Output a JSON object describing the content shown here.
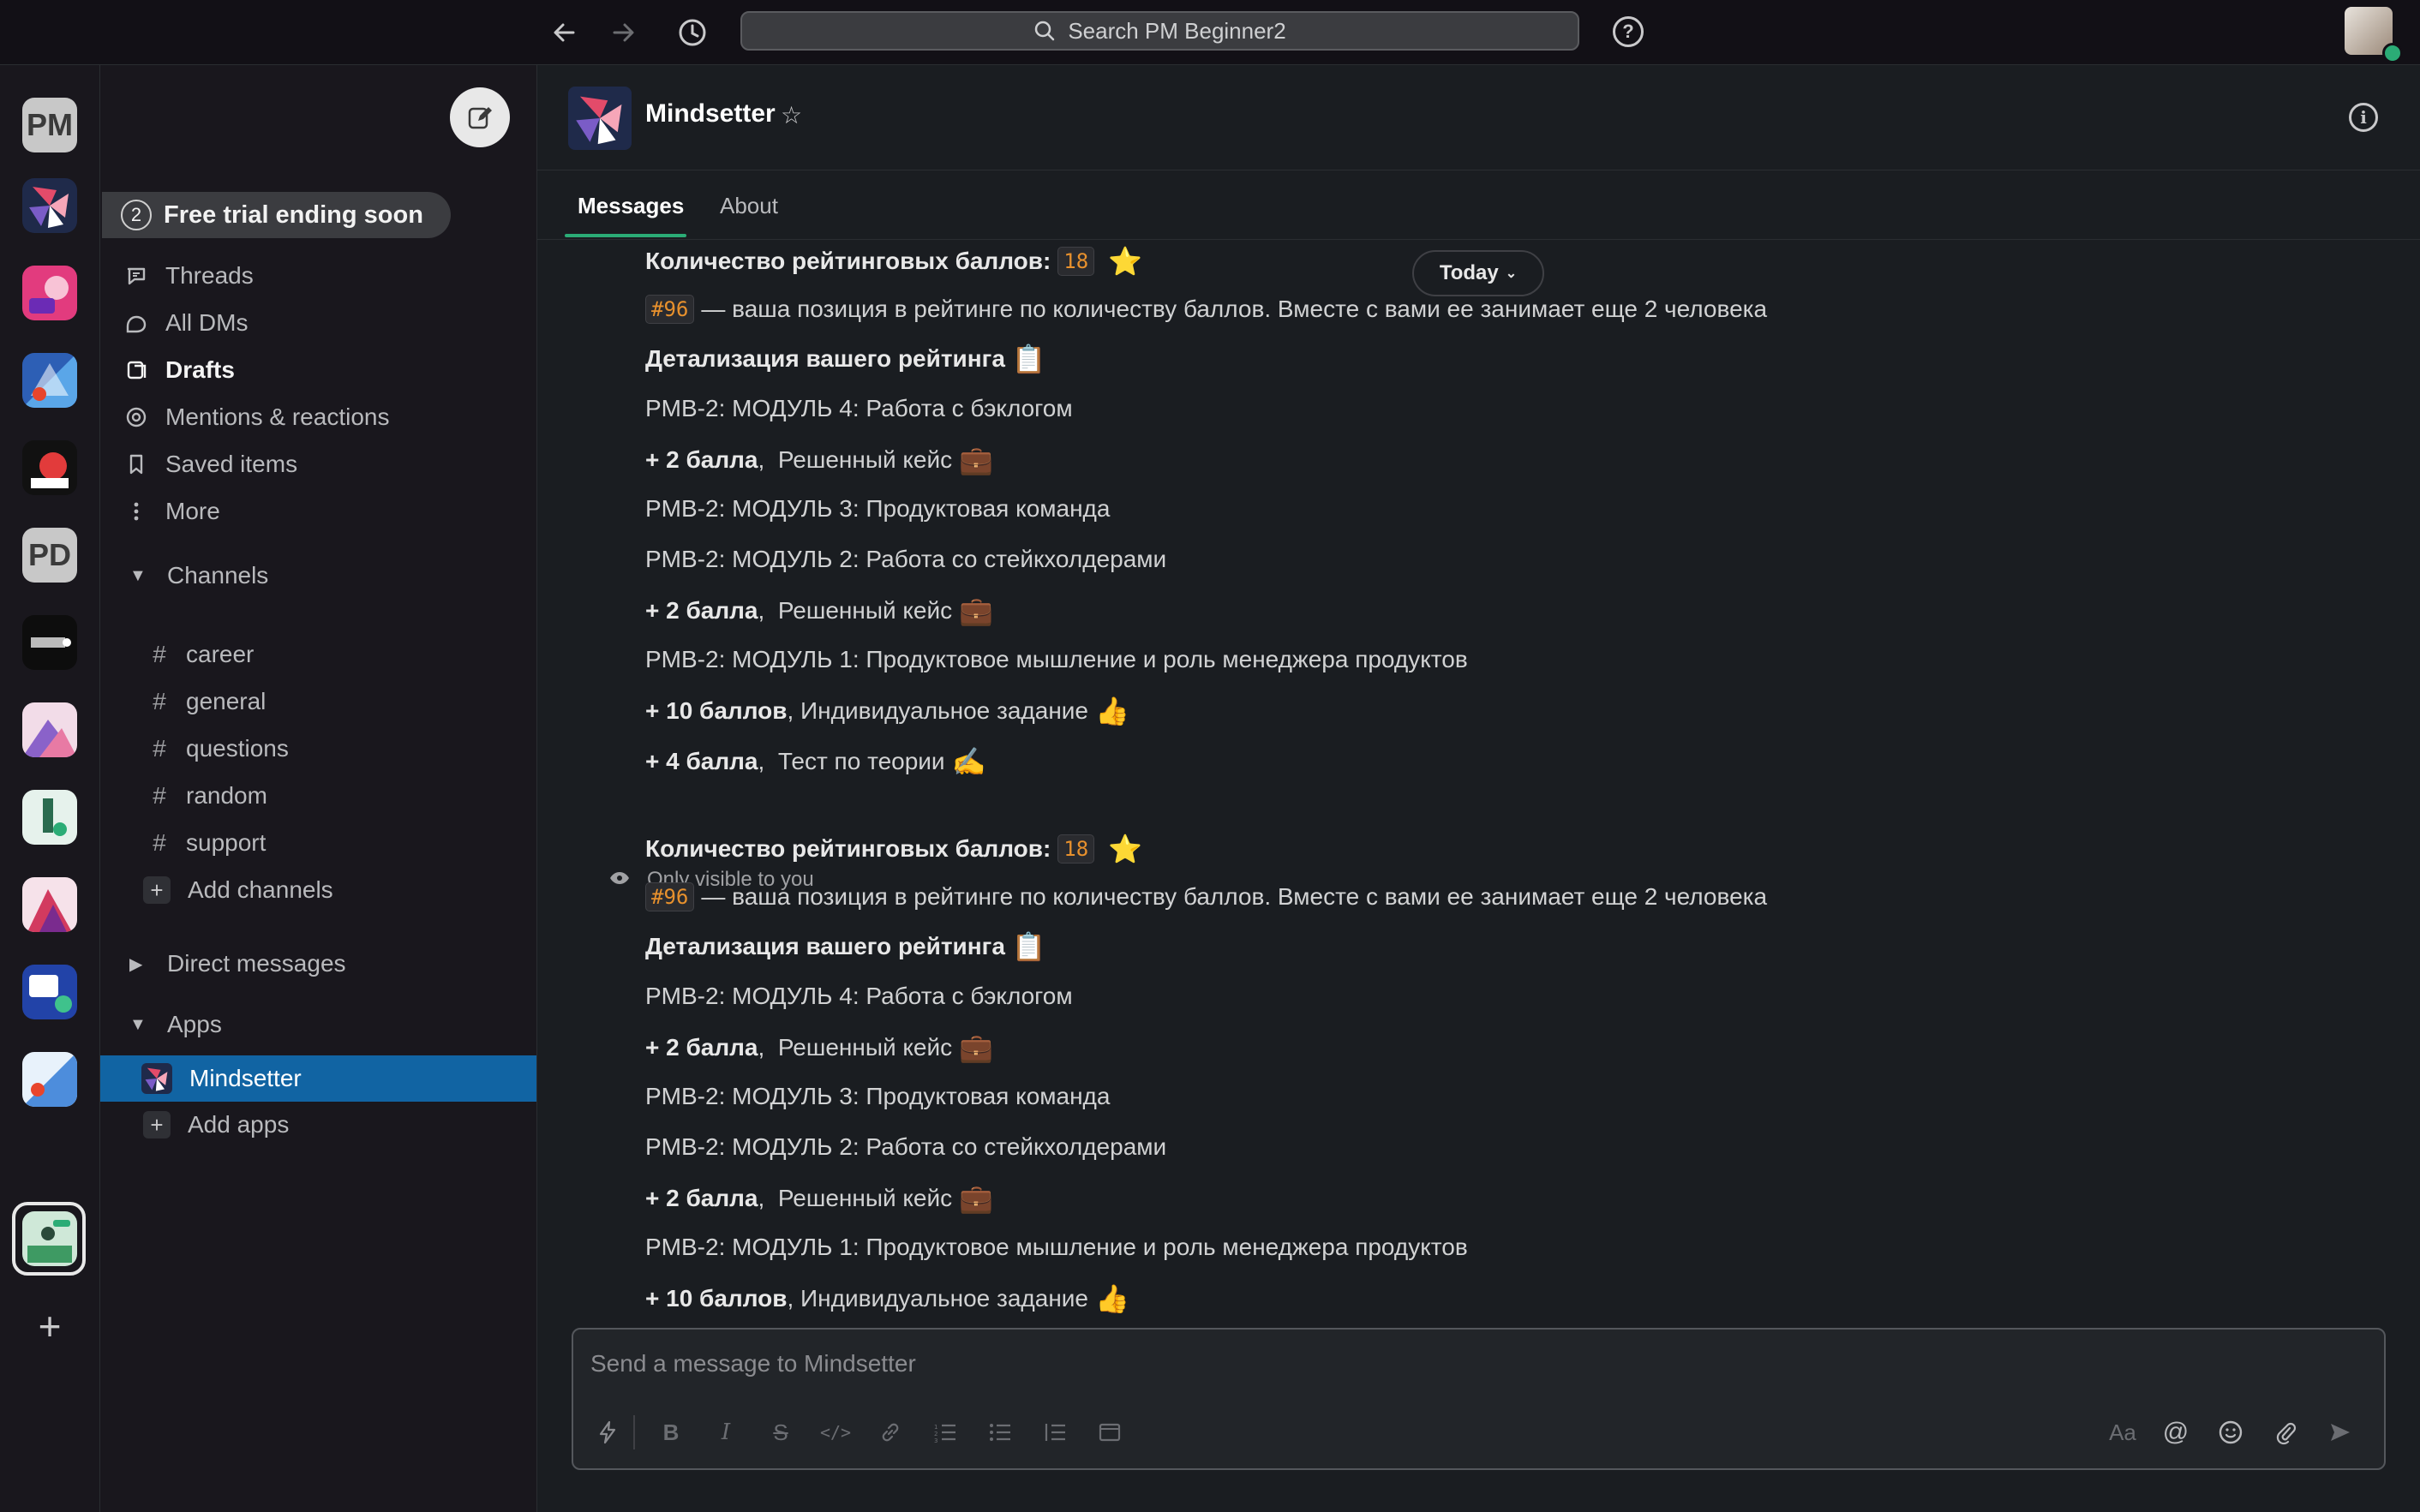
{
  "topbar": {
    "search_placeholder": "Search PM Beginner2",
    "back_icon": "arrow-left-icon",
    "forward_icon": "arrow-right-icon",
    "history_icon": "clock-icon",
    "help_label": "?"
  },
  "workspaces": {
    "pm_label": "PM",
    "pd_label": "PD",
    "add_label": "+"
  },
  "sidebar": {
    "trial_count": "2",
    "trial_label": "Free trial ending soon",
    "nav": [
      {
        "label": "Threads",
        "icon": "threads-icon"
      },
      {
        "label": "All DMs",
        "icon": "dms-icon"
      },
      {
        "label": "Drafts",
        "icon": "drafts-icon"
      },
      {
        "label": "Mentions & reactions",
        "icon": "at-icon"
      },
      {
        "label": "Saved items",
        "icon": "bookmark-icon"
      },
      {
        "label": "More",
        "icon": "more-icon"
      }
    ],
    "channels_header": "Channels",
    "channels": [
      {
        "name": "career"
      },
      {
        "name": "general"
      },
      {
        "name": "questions"
      },
      {
        "name": "random"
      },
      {
        "name": "support"
      }
    ],
    "add_channels": "Add channels",
    "direct_messages_header": "Direct messages",
    "apps_header": "Apps",
    "apps": [
      {
        "name": "Mindsetter"
      }
    ],
    "add_apps": "Add apps",
    "active_color": "#1164a3"
  },
  "channel": {
    "title": "Mindsetter",
    "tabs": [
      "Messages",
      "About"
    ],
    "today_label": "Today"
  },
  "messages": {
    "rating_label": "Количество рейтинговых баллов:",
    "rating_value": "18",
    "position_badge": "#96",
    "position_text": "— ваша позиция в рейтинге по количеству баллов. Вместе с вами ее занимает еще 2 человека",
    "details_label": "Детализация вашего рейтинга",
    "module4": "PMB-2: МОДУЛЬ 4: Работа с бэклогом",
    "module3": "PMB-2: МОДУЛЬ 3: Продуктовая команда",
    "module2": "PMB-2: МОДУЛЬ 2: Работа со стейкхолдерами",
    "module1": "PMB-2: МОДУЛЬ 1: Продуктовое мышление и роль менеджера продуктов",
    "pts2": "+ 2 балла",
    "case_text": "Решенный кейс",
    "pts10": "+ 10 баллов",
    "individual_text": "Индивидуальное задание",
    "pts4": "+ 4 балла",
    "theory_text": "Тест по теории",
    "only_visible": "Only visible to you",
    "accent_color": "#e8912d"
  },
  "composer": {
    "placeholder": "Send a message to Mindsetter",
    "format_label": "Aa"
  }
}
